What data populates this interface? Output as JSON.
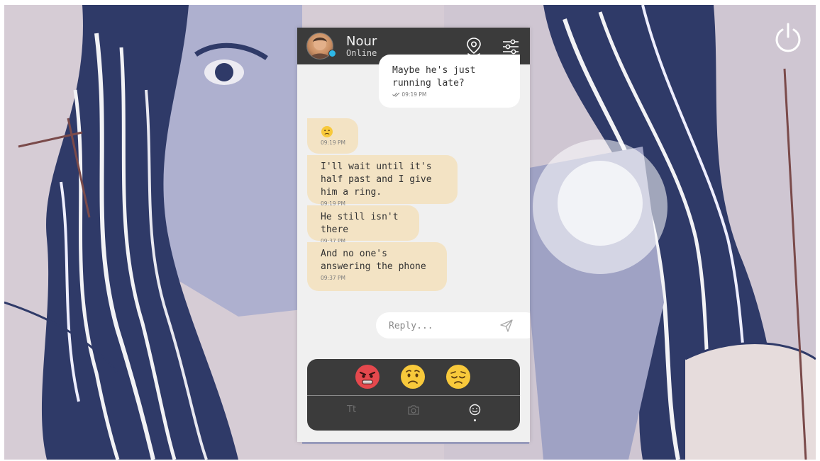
{
  "contact": {
    "name": "Nour",
    "status": "Online",
    "status_color": "#2db8e8"
  },
  "header_icons": [
    "location-pin-icon",
    "sliders-icon"
  ],
  "messages": [
    {
      "direction": "out",
      "text": "Maybe he's just running late?",
      "time": "09:19 PM",
      "read_receipt": "double-check-icon"
    },
    {
      "direction": "in",
      "emoji": "slightly-frowning-face-icon",
      "time": "09:19 PM"
    },
    {
      "direction": "in",
      "text": "I'll wait until it's half past and I give him a ring.",
      "time": "09:19 PM"
    },
    {
      "direction": "in",
      "text": "He still isn't there",
      "time": "09:37 PM"
    },
    {
      "direction": "in",
      "text": "And no one's answering the phone",
      "time": "09:37 PM"
    }
  ],
  "reply": {
    "placeholder": "Reply...",
    "value": ""
  },
  "emoji_options": [
    "angry-face-icon",
    "worried-face-icon",
    "disappointed-face-icon"
  ],
  "keyboard_tabs": [
    {
      "label": "Tt",
      "icon": "text-icon",
      "active": false
    },
    {
      "label": "",
      "icon": "camera-icon",
      "active": false
    },
    {
      "label": "",
      "icon": "smiley-icon",
      "active": true
    }
  ],
  "colors": {
    "header": "#3b3b3b",
    "incoming_bubble": "#f3e3c4",
    "outgoing_bubble": "#ffffff",
    "phone_background": "#f0f0f0"
  }
}
